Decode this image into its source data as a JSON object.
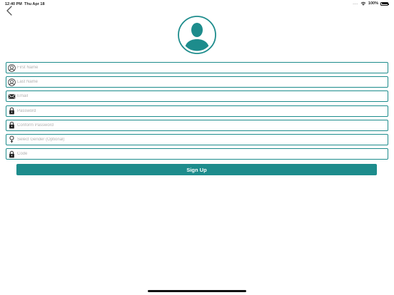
{
  "status_bar": {
    "time": "12:40 PM",
    "date": "Thu Apr 18",
    "signal": "....",
    "battery": "100%"
  },
  "icons": {
    "back": "chevron-left-icon",
    "avatar": "user-avatar-icon",
    "first_name": "person-face-icon",
    "last_name": "person-face-icon",
    "email": "envelope-icon",
    "password": "lock-icon",
    "confirm_password": "lock-icon",
    "gender": "female-symbol-icon",
    "code": "lock-icon"
  },
  "colors": {
    "accent": "#1d8c8c",
    "field_border": "#1d8c8c",
    "placeholder": "#b0b0b0",
    "button_text": "#ffffff"
  },
  "form": {
    "first_name": {
      "placeholder": "First Name",
      "value": ""
    },
    "last_name": {
      "placeholder": "Last Name",
      "value": ""
    },
    "email": {
      "placeholder": "Email",
      "value": ""
    },
    "password": {
      "placeholder": "Password",
      "value": ""
    },
    "confirm_password": {
      "placeholder": "Conform Password",
      "value": ""
    },
    "gender": {
      "placeholder": "Select Gender (Optional)",
      "value": ""
    },
    "code": {
      "placeholder": "Code",
      "value": ""
    }
  },
  "signup_button": {
    "label": "Sign Up"
  }
}
